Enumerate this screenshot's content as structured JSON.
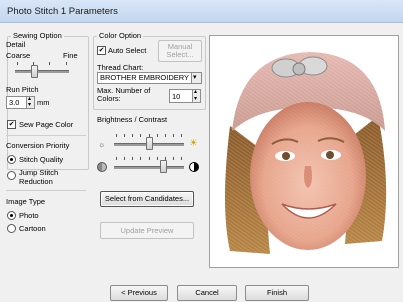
{
  "window": {
    "title": "Photo Stitch 1 Parameters"
  },
  "sewing_option": {
    "group_label": "Sewing Option",
    "detail_label": "Detail",
    "coarse_label": "Coarse",
    "fine_label": "Fine",
    "detail_level": 0.35,
    "run_pitch_label": "Run Pitch",
    "run_pitch_value": "3.0",
    "run_pitch_unit": "mm",
    "sew_page_color_label": "Sew Page Color",
    "sew_page_color_checked": true
  },
  "conversion_priority": {
    "group_label": "Conversion Priority",
    "options": [
      {
        "label": "Stitch Quality",
        "selected": true
      },
      {
        "label": "Jump Stitch Reduction",
        "selected": false
      }
    ]
  },
  "image_type": {
    "group_label": "Image Type",
    "options": [
      {
        "label": "Photo",
        "selected": true
      },
      {
        "label": "Cartoon",
        "selected": false
      }
    ]
  },
  "color_option": {
    "group_label": "Color Option",
    "auto_select_label": "Auto Select",
    "auto_select_checked": true,
    "manual_select_label": "Manual Select...",
    "thread_chart_label": "Thread Chart:",
    "thread_chart_value": "BROTHER EMBROIDERY",
    "max_colors_label": "Max. Number of Colors:",
    "max_colors_value": "10"
  },
  "brightness_contrast": {
    "label": "Brightness / Contrast",
    "brightness_level": 0.5,
    "contrast_level": 0.7
  },
  "buttons": {
    "select_from_candidates": "Select from Candidates...",
    "update_preview": "Update Preview",
    "previous": "< Previous",
    "cancel": "Cancel",
    "finish": "Finish"
  },
  "icons": {
    "brightness_low": "sun-small-icon",
    "brightness_high": "sun-large-icon",
    "contrast_low": "contrast-low-icon",
    "contrast_high": "contrast-high-icon"
  },
  "preview": {
    "description_icon": "embroidery-preview-image"
  }
}
